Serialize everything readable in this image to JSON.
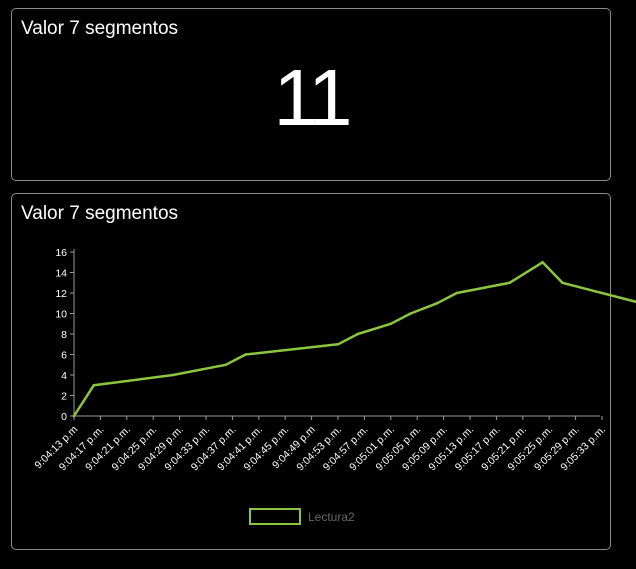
{
  "value_card": {
    "title": "Valor 7 segmentos",
    "value": "11"
  },
  "chart_card": {
    "title": "Valor 7 segmentos"
  },
  "colors": {
    "background": "#000000",
    "card_border": "#8a8a8a",
    "series_line": "#8cc63f",
    "axis": "#9a9a9a",
    "legend_text": "#666666"
  },
  "chart_data": {
    "type": "line",
    "title": "",
    "xlabel": "",
    "ylabel": "",
    "ylim": [
      0,
      16
    ],
    "y_ticks": [
      0,
      2,
      4,
      6,
      8,
      10,
      12,
      14,
      16
    ],
    "x": [
      "9:04:13 p.m.",
      "9:04:17 p.m.",
      "9:04:21 p.m.",
      "9:04:25 p.m.",
      "9:04:29 p.m.",
      "9:04:33 p.m.",
      "9:04:37 p.m.",
      "9:04:41 p.m.",
      "9:04:45 p.m.",
      "9:04:49 p.m.",
      "9:04:53 p.m.",
      "9:04:57 p.m.",
      "9:05:01 p.m.",
      "9:05:05 p.m.",
      "9:05:09 p.m.",
      "9:05:13 p.m.",
      "9:05:17 p.m.",
      "9:05:21 p.m.",
      "9:05:25 p.m.",
      "9:05:29 p.m.",
      "9:05:33 p.m."
    ],
    "x_tick_labels": [
      "9:04:13 p.m",
      "9:04:17 p.m.",
      "9:04:21 p.m.",
      "9:04:25 p.m.",
      "9:04:29 p.m.",
      "9:04:33 p.m.",
      "9:04:37 p.m.",
      "9:04:41 p.m.",
      "9:04:45 p.m.",
      "9:04:49 p.m",
      "9:04:53 p.m.",
      "9:04:57 p.m.",
      "9:05:01 p.m.",
      "9:05:05 p.m.",
      "9:05:09 p.m.",
      "9:05:13 p.m.",
      "9:05:17 p.m.",
      "9:05:21 p.m.",
      "9:05:25 p.m.",
      "9:05:29 p.m.",
      "9:05:33 p.m."
    ],
    "series": [
      {
        "name": "Lectura2",
        "color": "#8cc63f",
        "points": [
          [
            "9:04:13 p.m.",
            0
          ],
          [
            "9:04:16 p.m.",
            3
          ],
          [
            "9:04:28 p.m.",
            4
          ],
          [
            "9:04:36 p.m.",
            5
          ],
          [
            "9:04:39 p.m.",
            6
          ],
          [
            "9:04:53 p.m.",
            7
          ],
          [
            "9:04:56 p.m.",
            8
          ],
          [
            "9:05:01 p.m.",
            9
          ],
          [
            "9:05:04 p.m.",
            10
          ],
          [
            "9:05:08 p.m.",
            11
          ],
          [
            "9:05:11 p.m.",
            12
          ],
          [
            "9:05:19 p.m.",
            13
          ],
          [
            "9:05:24 p.m.",
            15
          ],
          [
            "9:05:27 p.m.",
            13
          ],
          [
            "9:05:39 p.m.",
            11
          ]
        ]
      }
    ],
    "legend": {
      "position": "bottom-center"
    },
    "grid": false
  }
}
